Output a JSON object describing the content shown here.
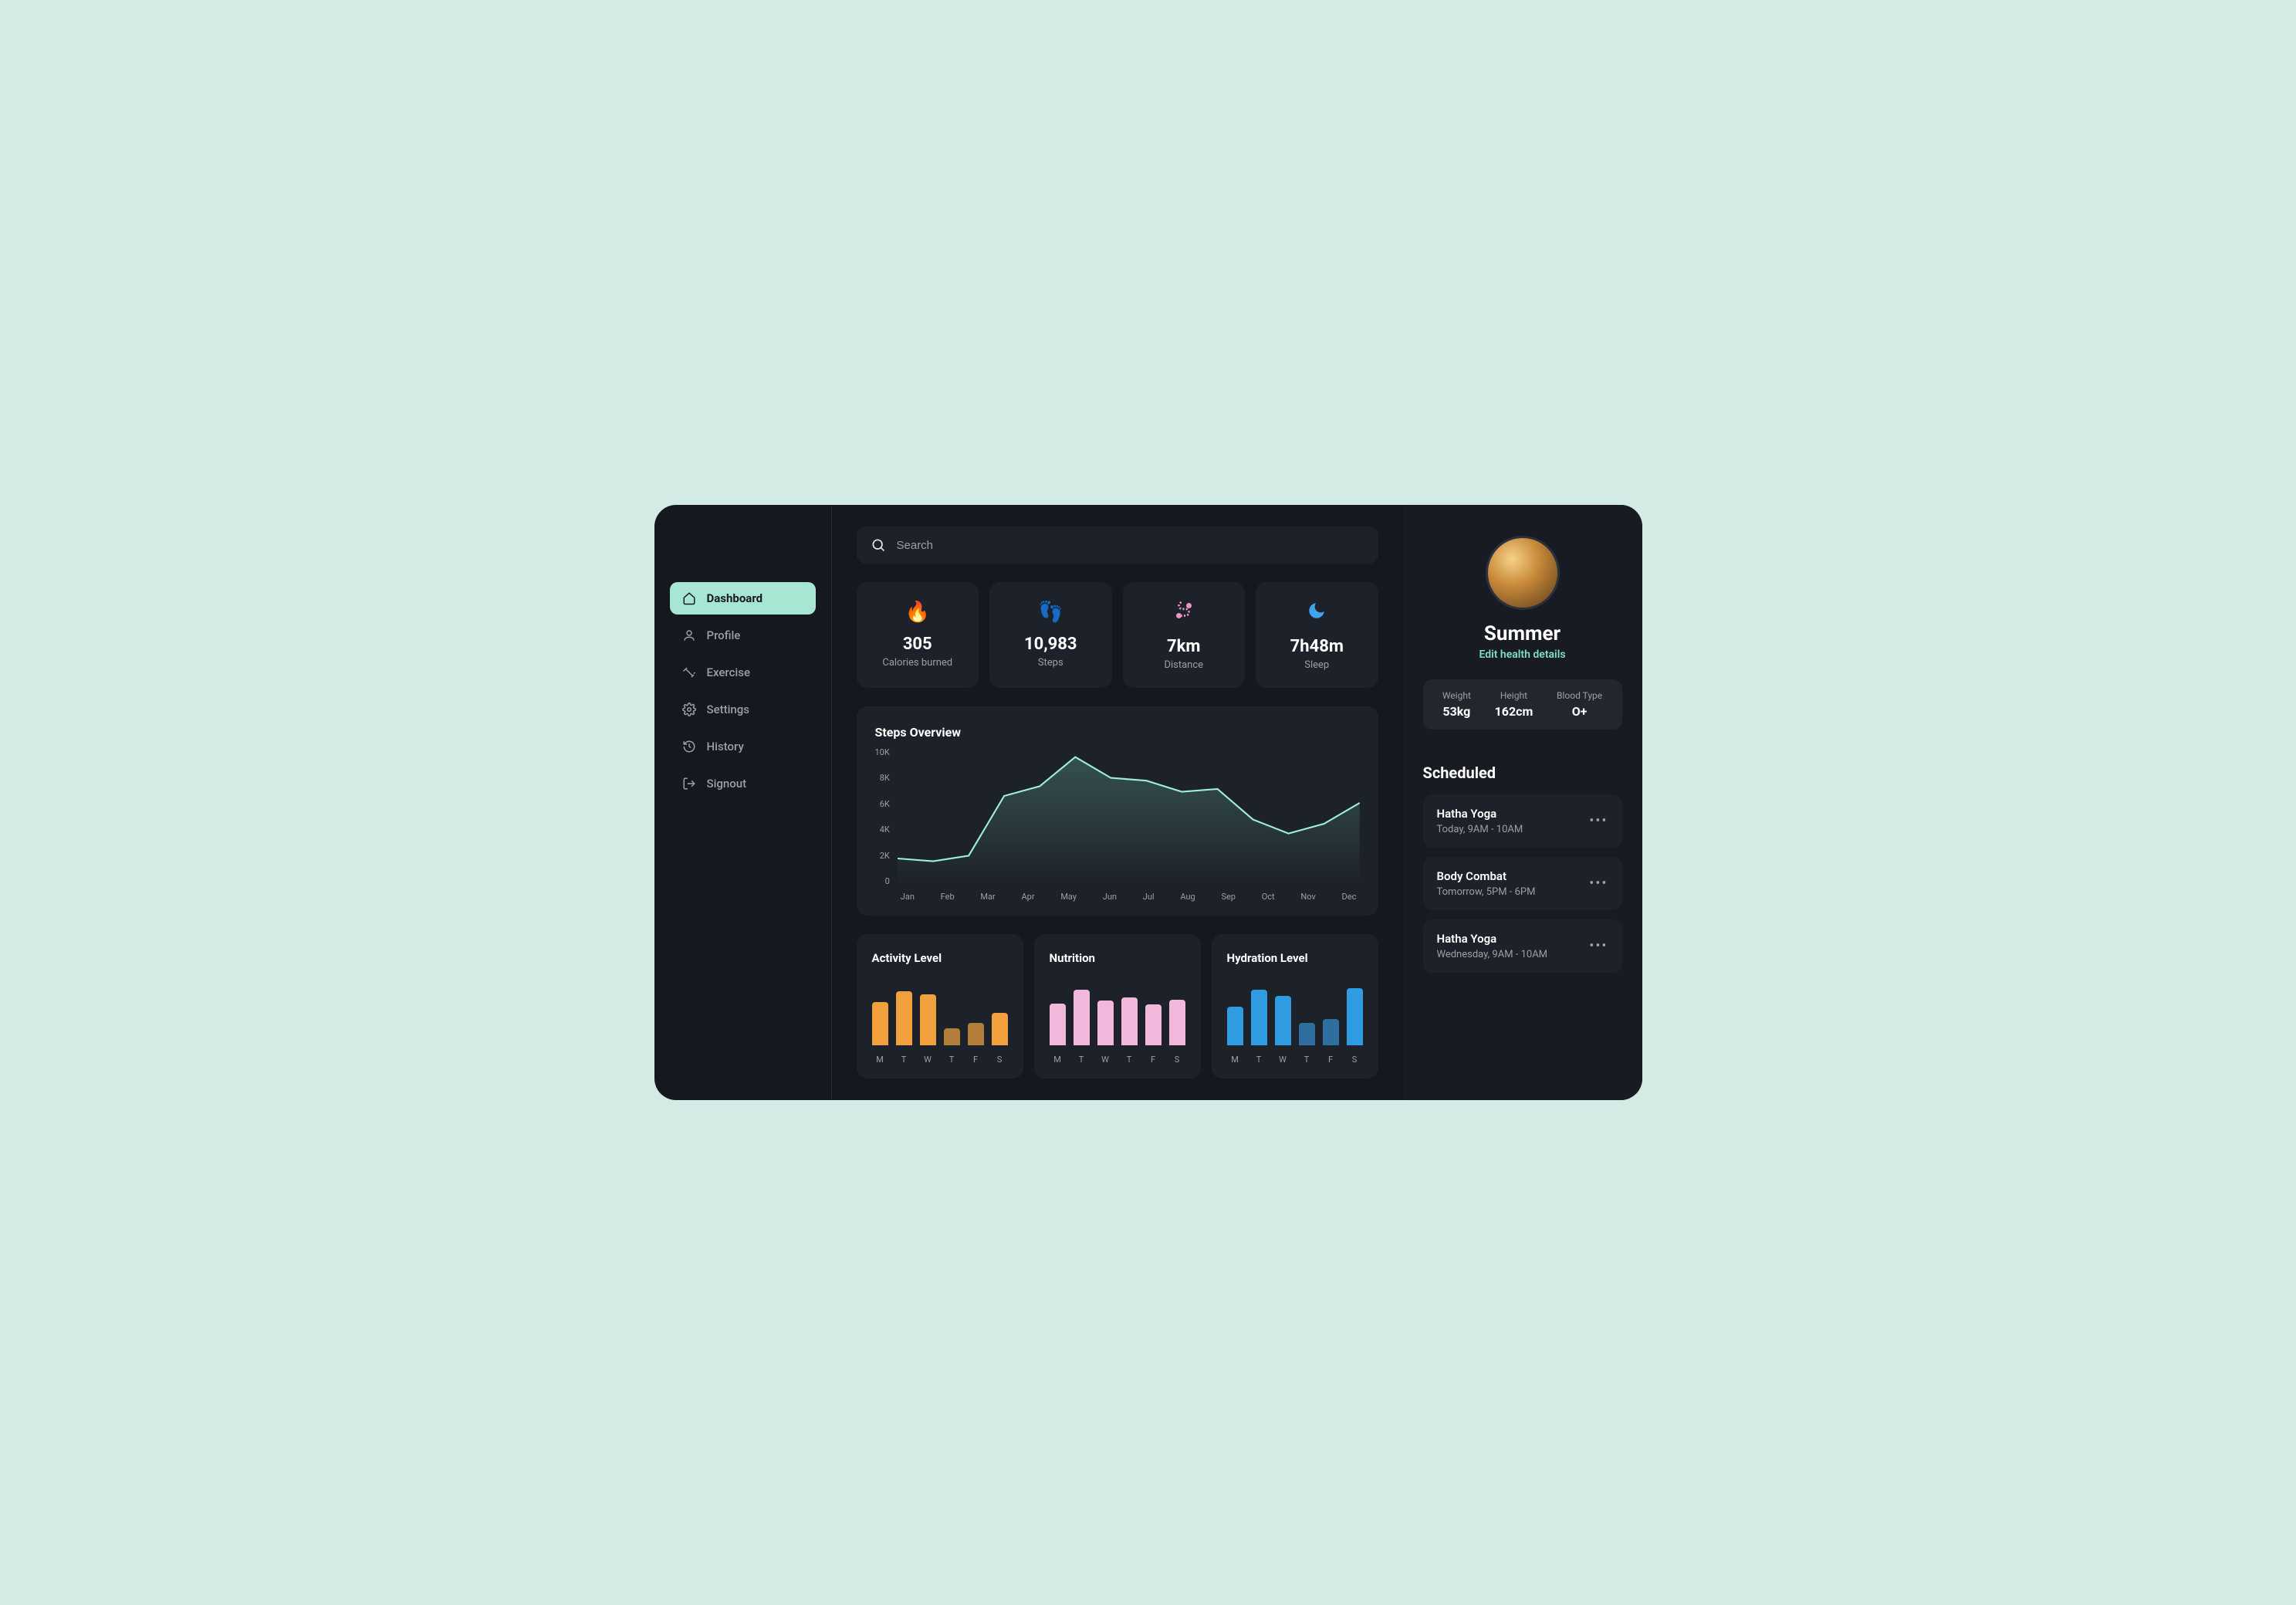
{
  "sidebar": {
    "items": [
      {
        "label": "Dashboard",
        "active": true,
        "icon": "home"
      },
      {
        "label": "Profile",
        "active": false,
        "icon": "user"
      },
      {
        "label": "Exercise",
        "active": false,
        "icon": "dumbbell"
      },
      {
        "label": "Settings",
        "active": false,
        "icon": "gear"
      },
      {
        "label": "History",
        "active": false,
        "icon": "history"
      },
      {
        "label": "Signout",
        "active": false,
        "icon": "signout"
      }
    ]
  },
  "search": {
    "placeholder": "Search"
  },
  "stats": [
    {
      "value": "305",
      "label": "Calories burned",
      "icon": "flame",
      "color": "#f2a03d"
    },
    {
      "value": "10,983",
      "label": "Steps",
      "icon": "feet",
      "color": "#7fe0c4"
    },
    {
      "value": "7km",
      "label": "Distance",
      "icon": "route",
      "color": "#f093c9"
    },
    {
      "value": "7h48m",
      "label": "Sleep",
      "icon": "moon",
      "color": "#3fa4ee"
    }
  ],
  "chart_data": {
    "type": "area",
    "title": "Steps Overview",
    "categories": [
      "Jan",
      "Feb",
      "Mar",
      "Apr",
      "May",
      "Jun",
      "Jul",
      "Aug",
      "Sep",
      "Oct",
      "Nov",
      "Dec"
    ],
    "values": [
      2000,
      1800,
      2200,
      6500,
      7200,
      9300,
      7800,
      7600,
      6800,
      7000,
      4800,
      3800,
      4500,
      6000
    ],
    "ylabel": "",
    "xlabel": "",
    "ylim": [
      0,
      10000
    ],
    "y_ticks": [
      "10K",
      "8K",
      "6K",
      "4K",
      "2K",
      "0"
    ]
  },
  "mini_charts": [
    {
      "title": "Activity Level",
      "type": "bar",
      "categories": [
        "M",
        "T",
        "W",
        "T",
        "F",
        "S"
      ],
      "values": [
        70,
        88,
        82,
        28,
        36,
        52
      ],
      "colors": [
        "#f2a03d",
        "#f2a03d",
        "#f2a03d",
        "#b37d3a",
        "#b37d3a",
        "#f2a03d"
      ]
    },
    {
      "title": "Nutrition",
      "type": "bar",
      "categories": [
        "M",
        "T",
        "W",
        "T",
        "F",
        "S"
      ],
      "values": [
        68,
        90,
        72,
        78,
        66,
        74
      ],
      "colors": [
        "#f2b8dc",
        "#f2b8dc",
        "#f2b8dc",
        "#f2b8dc",
        "#f2b8dc",
        "#f2b8dc"
      ]
    },
    {
      "title": "Hydration Level",
      "type": "bar",
      "categories": [
        "M",
        "T",
        "W",
        "T",
        "F",
        "S"
      ],
      "values": [
        62,
        90,
        80,
        36,
        42,
        92
      ],
      "colors": [
        "#2f9be0",
        "#2f9be0",
        "#2f9be0",
        "#2e6fa0",
        "#2e6fa0",
        "#2f9be0"
      ]
    }
  ],
  "profile": {
    "name": "Summer",
    "edit_label": "Edit health details",
    "health": [
      {
        "label": "Weight",
        "value": "53kg"
      },
      {
        "label": "Height",
        "value": "162cm"
      },
      {
        "label": "Blood Type",
        "value": "O+"
      }
    ]
  },
  "scheduled": {
    "title": "Scheduled",
    "items": [
      {
        "name": "Hatha Yoga",
        "time": "Today, 9AM - 10AM"
      },
      {
        "name": "Body Combat",
        "time": "Tomorrow, 5PM - 6PM"
      },
      {
        "name": "Hatha Yoga",
        "time": "Wednesday, 9AM - 10AM"
      }
    ]
  }
}
